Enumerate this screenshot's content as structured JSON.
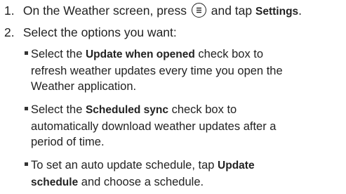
{
  "steps": [
    {
      "num": "1.",
      "before": "On the Weather screen, press",
      "icon": "menu-key-icon",
      "middle": "and tap",
      "bold": "Settings",
      "after": "."
    },
    {
      "num": "2.",
      "text": "Select the options you want:"
    }
  ],
  "bullets": [
    {
      "line1_pre": "Select the ",
      "line1_bold": "Update when opened",
      "line1_post": " check box to",
      "line2": "refresh weather updates every time you open the",
      "line3": "Weather application."
    },
    {
      "line1_pre": "Select the ",
      "line1_bold": "Scheduled sync",
      "line1_post": " check box to",
      "line2": "automatically download weather updates after a",
      "line3": "period of time."
    },
    {
      "line1_pre": "To set an auto update schedule, tap ",
      "line1_bold": "Update",
      "line2_bold": "schedule",
      "line2_post": " and choose a schedule."
    }
  ]
}
